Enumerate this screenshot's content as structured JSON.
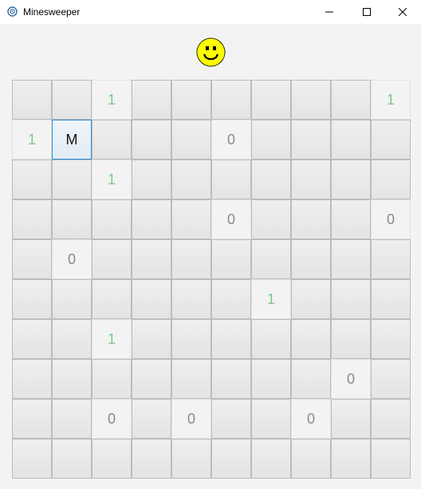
{
  "window": {
    "title": "Minesweeper",
    "icons": [
      "app-icon",
      "minimize-icon",
      "maximize-icon",
      "close-icon"
    ]
  },
  "status": {
    "face_icon": "smiley-face-icon",
    "face_color": "#ffff00"
  },
  "board": {
    "rows": 10,
    "cols": 10,
    "cells": [
      [
        "",
        "",
        "1",
        "",
        "",
        "",
        "",
        "",
        "",
        "1"
      ],
      [
        "1",
        "M",
        "",
        "",
        "",
        "0",
        "",
        "",
        "",
        ""
      ],
      [
        "",
        "",
        "1",
        "",
        "",
        "",
        "",
        "",
        "",
        ""
      ],
      [
        "",
        "",
        "",
        "",
        "",
        "0",
        "",
        "",
        "",
        "0"
      ],
      [
        "",
        "0",
        "",
        "",
        "",
        "",
        "",
        "",
        "",
        ""
      ],
      [
        "",
        "",
        "",
        "",
        "",
        "",
        "1",
        "",
        "",
        ""
      ],
      [
        "",
        "",
        "1",
        "",
        "",
        "",
        "",
        "",
        "",
        ""
      ],
      [
        "",
        "",
        "",
        "",
        "",
        "",
        "",
        "",
        "0",
        ""
      ],
      [
        "",
        "",
        "0",
        "",
        "0",
        "",
        "",
        "0",
        "",
        ""
      ],
      [
        "",
        "",
        "",
        "",
        "",
        "",
        "",
        "",
        "",
        ""
      ]
    ],
    "colors": {
      "one": "#7cc88a",
      "zero": "#8a8a8a",
      "selected_border": "#2b8fd6"
    }
  }
}
